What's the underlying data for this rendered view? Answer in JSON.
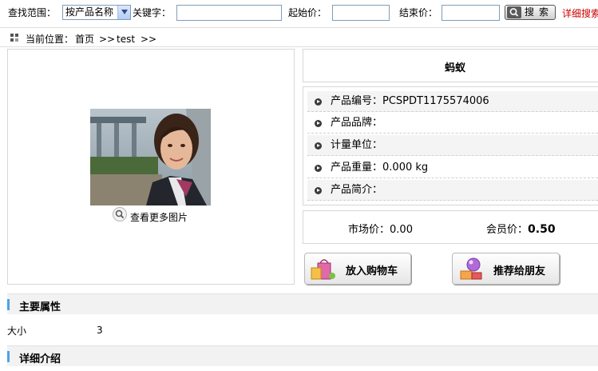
{
  "search": {
    "scope_label": "查找范围：",
    "scope_selected": "按产品名称",
    "keyword_label": "关键字：",
    "keyword_value": "",
    "start_price_label": "起始价：",
    "start_price_value": "",
    "end_price_label": "结束价：",
    "end_price_value": "",
    "search_button": "搜索",
    "advanced_link": "详细搜索"
  },
  "breadcrumb": {
    "prefix": "当前位置：",
    "home": "首页",
    "sep1": ">>",
    "current": "test",
    "sep2": ">>"
  },
  "product": {
    "name": "蚂蚁",
    "more_images": "查看更多图片",
    "code_label": "产品编号：",
    "code_value": "PCSPDT1175574006",
    "brand_label": "产品品牌：",
    "brand_value": "",
    "unit_label": "计量单位：",
    "unit_value": "",
    "weight_label": "产品重量：",
    "weight_value": "0.000 kg",
    "intro_label": "产品简介：",
    "intro_value": ""
  },
  "prices": {
    "market_label": "市场价：",
    "market_value": "0.00",
    "member_label": "会员价：",
    "member_value": "0.50"
  },
  "actions": {
    "cart": "放入购物车",
    "recommend": "推荐给朋友"
  },
  "sections": {
    "attributes_title": "主要属性",
    "attributes": [
      {
        "name": "大小",
        "value": "3"
      }
    ],
    "details_title": "详细介绍"
  },
  "colors": {
    "accent_bar": "#4ea2e5",
    "advanced_link": "#cc0000"
  },
  "icons": [
    "chevron-down-icon",
    "search-icon",
    "location-icon",
    "zoom-icon",
    "bullet-arrow-icon",
    "shopping-bag-icon",
    "gift-icon"
  ]
}
